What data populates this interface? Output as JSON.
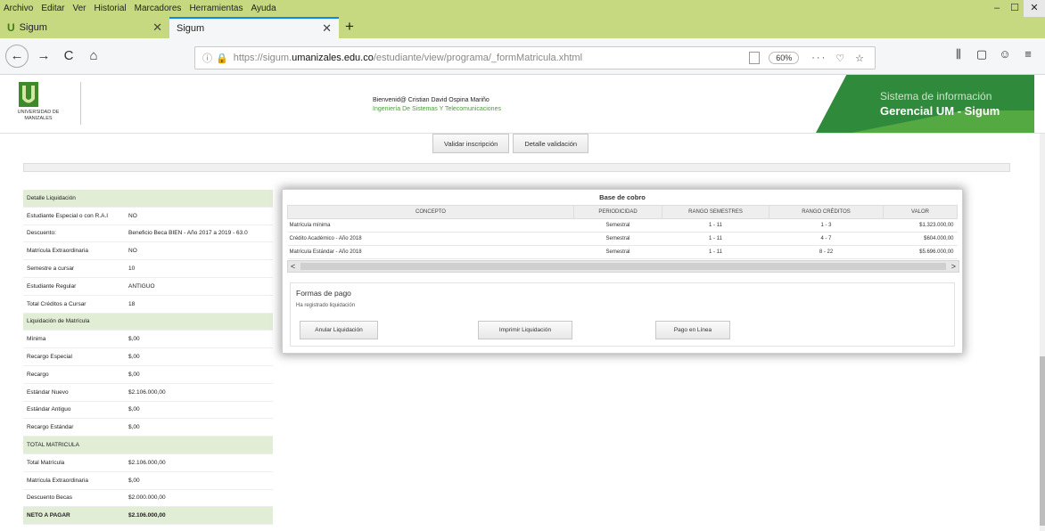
{
  "menubar": {
    "items": [
      "Archivo",
      "Editar",
      "Ver",
      "Historial",
      "Marcadores",
      "Herramientas",
      "Ayuda"
    ],
    "window_controls": [
      "–",
      "☐",
      "✕"
    ]
  },
  "tabs": [
    {
      "title": "Sigum",
      "close": "✕",
      "favicon": "U"
    },
    {
      "title": "Sigum",
      "close": "✕"
    }
  ],
  "new_tab": "+",
  "nav": {
    "back": "←",
    "forward": "→",
    "reload": "C",
    "home": "⌂",
    "url_prefix": "https://sigum.",
    "url_domain": "umanizales.edu.co",
    "url_path": "/estudiante/view/programa/_formMatricula.xhtml",
    "zoom": "60%",
    "more": "···",
    "pocket": "♡",
    "bookmark": "☆",
    "library": "⫼",
    "sidebar": "▢",
    "account": "☺",
    "menu": "≡"
  },
  "header": {
    "logo_text_1": "UNIVERSIDAD DE",
    "logo_text_2": "MANIZALES",
    "welcome": "Bienvenid@ Cristian David Ospina Mariño",
    "program": "Ingeniería De Sistemas Y Telecomunicaciones",
    "brand_line1": "Sistema de información",
    "brand_line2": "Gerencial UM - Sigum"
  },
  "actions": {
    "validate": "Validar inscripción",
    "details": "Detalle validación"
  },
  "liquidacion": {
    "rows": [
      {
        "type": "section",
        "label": "Detalle Liquidación",
        "value": ""
      },
      {
        "label": "Estudiante Especial o con R.A.I",
        "value": "NO"
      },
      {
        "label": "Descuento:",
        "value": "Beneficio Beca BIEN - Año 2017 a 2019 - 63.0"
      },
      {
        "label": "Matrícula Extraordinaria",
        "value": "NO"
      },
      {
        "label": "Semestre a cursar",
        "value": "10"
      },
      {
        "label": "Estudiante Regular",
        "value": "ANTIGUO"
      },
      {
        "label": "Total Créditos a Cursar",
        "value": "18"
      },
      {
        "type": "section",
        "label": "Liquidación de Matrícula",
        "value": ""
      },
      {
        "label": "Mínima",
        "value": "$,00"
      },
      {
        "label": "Recargo Especial",
        "value": "$,00"
      },
      {
        "label": "Recargo",
        "value": "$,00"
      },
      {
        "label": "Estándar Nuevo",
        "value": "$2.106.000,00"
      },
      {
        "label": "Estándar Antiguo",
        "value": "$,00"
      },
      {
        "label": "Recargo Estándar",
        "value": "$,00"
      },
      {
        "type": "section",
        "label": "TOTAL MATRICULA",
        "value": ""
      },
      {
        "label": "Total Matrícula",
        "value": "$2.106.000,00"
      },
      {
        "label": "Matrícula Extraordinaria",
        "value": "$,00"
      },
      {
        "label": "Descuento Becas",
        "value": "$2.000.000,00"
      },
      {
        "type": "net",
        "label": "NETO A PAGAR",
        "value": "$2.106.000,00"
      }
    ]
  },
  "cobro": {
    "title": "Base de cobro",
    "columns": [
      "CONCEPTO",
      "PERIODICIDAD",
      "RANGO SEMESTRES",
      "RANGO CRÉDITOS",
      "VALOR"
    ],
    "rows": [
      [
        "Matrícula mínima",
        "Semestral",
        "1 - 11",
        "1 - 3",
        "$1.323.000,00"
      ],
      [
        "Crédito Académico - Año 2018",
        "Semestral",
        "1 - 11",
        "4 - 7",
        "$604.000,00"
      ],
      [
        "Matrícula Estándar - Año 2018",
        "Semestral",
        "1 - 11",
        "8 - 22",
        "$5.696.000,00"
      ]
    ],
    "scroll_left": "<",
    "scroll_right": ">",
    "formas_title": "Formas de pago",
    "formas_note": "Ha registrado liquidación",
    "btn_anular": "Anular Liquidación",
    "btn_imprimir": "Imprimir Liquidación",
    "btn_pago": "Pago en Línea"
  },
  "colors": {
    "chrome": "#c6d981",
    "brand": "#2f8a3b",
    "section_bg": "#e2edd6",
    "accent_tab": "#0a84ff"
  }
}
